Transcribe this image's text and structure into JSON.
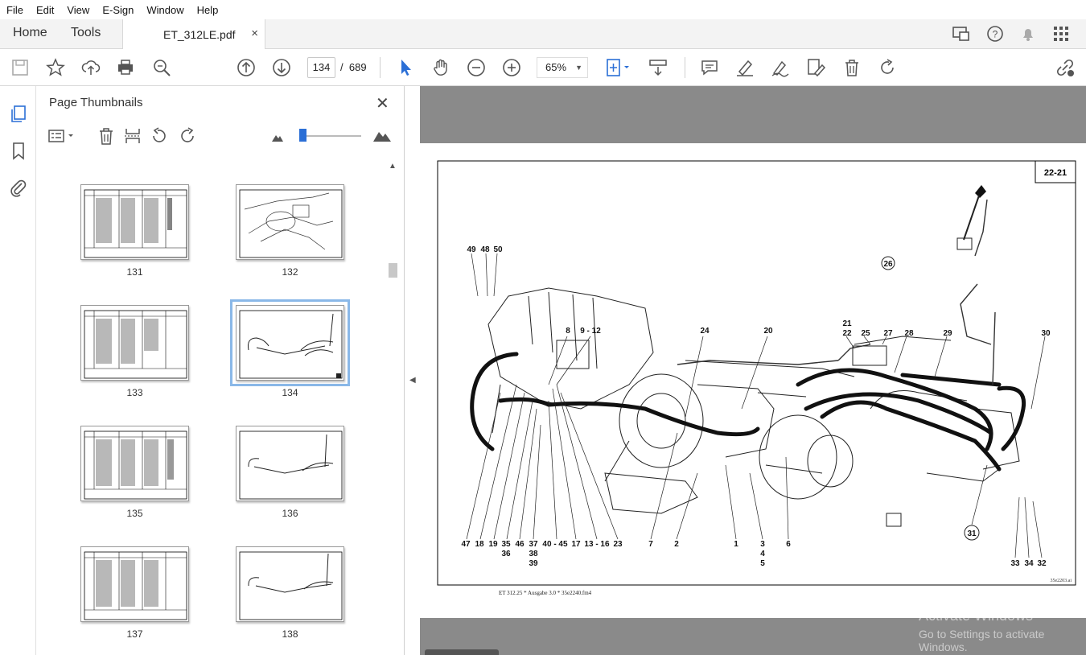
{
  "menu": [
    "File",
    "Edit",
    "View",
    "E-Sign",
    "Window",
    "Help"
  ],
  "tabs": {
    "home": "Home",
    "tools": "Tools",
    "document": "ET_312LE.pdf",
    "close": "×"
  },
  "toolbar": {
    "current_page": "134",
    "separator": "/",
    "total_pages": "689",
    "zoom": "65%"
  },
  "panel": {
    "title": "Page Thumbnails",
    "thumbnails": [
      {
        "label": "131",
        "kind": "table"
      },
      {
        "label": "132",
        "kind": "drawing"
      },
      {
        "label": "133",
        "kind": "table"
      },
      {
        "label": "134",
        "kind": "drawing",
        "selected": true
      },
      {
        "label": "135",
        "kind": "table"
      },
      {
        "label": "136",
        "kind": "drawing"
      },
      {
        "label": "137",
        "kind": "table"
      },
      {
        "label": "138",
        "kind": "drawing"
      }
    ]
  },
  "page": {
    "section_badge": "22-21",
    "drawing_ref": "35e2203.ai",
    "footer": "ET 312.25 * Ausgabe 3.0 * 35e2240.fm4",
    "callouts_top": [
      "49",
      "48",
      "50",
      "8",
      "9 - 12",
      "24",
      "20",
      "21",
      "22",
      "25",
      "26",
      "27",
      "28",
      "29",
      "30"
    ],
    "callouts_bottom": [
      "47",
      "18",
      "19",
      "35",
      "36",
      "46",
      "37",
      "38",
      "39",
      "40 - 45",
      "17",
      "13 - 16",
      "23",
      "7",
      "2",
      "1",
      "3",
      "4",
      "5",
      "6",
      "31",
      "33",
      "34",
      "32"
    ]
  },
  "watermark": {
    "line1": "Activate Windows",
    "line2": "Go to Settings to activate Windows."
  },
  "icons": {
    "toolbar": [
      "save-icon",
      "star-icon",
      "upload-icon",
      "print-icon",
      "search-zoom-icon",
      "page-up-icon",
      "page-down-icon",
      "pointer-icon",
      "hand-icon",
      "zoom-out-icon",
      "zoom-in-icon",
      "fit-page-icon",
      "scroll-mode-icon",
      "comment-icon",
      "highlight-icon",
      "sign-icon",
      "edit-icon",
      "delete-icon",
      "rotate-icon",
      "share-link-icon"
    ]
  },
  "colors": {
    "selection": "#8ab8e8",
    "accent": "#2b6fd6",
    "doc_background": "#8a8a8a"
  }
}
